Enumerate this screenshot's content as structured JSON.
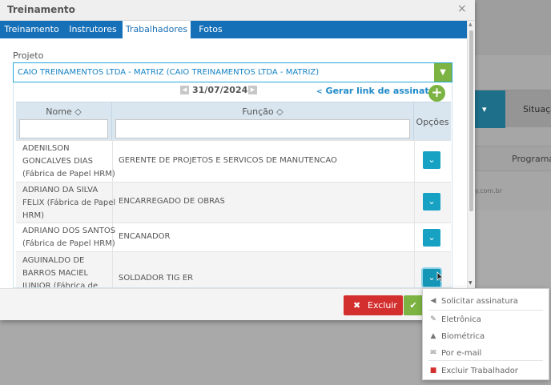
{
  "background": {
    "column_header_label": "Situaçã",
    "row_status": "Programad",
    "footer_text": "y.com.br",
    "blue_header_caret": "▾"
  },
  "modal": {
    "title": "Treinamento",
    "close_glyph": "×",
    "tabs": [
      {
        "label": "Treinamento"
      },
      {
        "label": "Instrutores"
      },
      {
        "label": "Trabalhadores"
      },
      {
        "label": "Fotos"
      }
    ],
    "active_tab": "Trabalhadores",
    "projeto": {
      "label": "Projeto",
      "value": "CAIO TREINAMENTOS LTDA - MATRIZ (CAIO TREINAMENTOS LTDA - MATRIZ)"
    },
    "date": "31/07/2024",
    "share_link_label": "Gerar link de assinatura",
    "table": {
      "headers": {
        "nome": "Nome",
        "funcao": "Função",
        "opcoes": "Opções"
      },
      "sort_glyph": "◇",
      "rows": [
        {
          "name_lines": [
            "ADENILSON",
            "GONCALVES DIAS",
            "(Fábrica de Papel HRM)"
          ],
          "function": "GERENTE DE PROJETOS E SERVICOS DE MANUTENCAO"
        },
        {
          "name_lines": [
            "ADRIANO DA SILVA",
            "FELIX (Fábrica de Papel",
            "HRM)"
          ],
          "function": "ENCARREGADO DE OBRAS"
        },
        {
          "name_lines": [
            "ADRIANO DOS SANTOS",
            "(Fábrica de Papel HRM)"
          ],
          "function": "ENCANADOR"
        },
        {
          "name_lines": [
            "AGUINALDO DE",
            "BARROS MACIEL",
            "JUNIOR (Fábrica de"
          ],
          "function": "SOLDADOR TIG ER"
        }
      ]
    },
    "footer": {
      "delete_label": "Excluir",
      "delete_icon": "✖",
      "ok_icon": "✔"
    }
  },
  "dropdown": {
    "items": [
      {
        "label": "Solicitar assinatura",
        "icon": "megaphone-icon",
        "glyph": "📢"
      },
      {
        "label": "Eletrônica",
        "icon": "edit-icon",
        "glyph": "✎"
      },
      {
        "label": "Biométrica",
        "icon": "thumbs-up-icon",
        "glyph": "👍"
      },
      {
        "label": "Por e-mail",
        "icon": "envelope-icon",
        "glyph": "✉"
      },
      {
        "label": "Excluir Trabalhador",
        "icon": "trash-icon",
        "glyph": "🗑"
      }
    ]
  },
  "colors": {
    "tab_bar": "#1670b8",
    "accent_green": "#7cb342",
    "option_button": "#17a2c4",
    "delete_red": "#d32f2f",
    "delete_item_icon": "#d32f2f"
  }
}
